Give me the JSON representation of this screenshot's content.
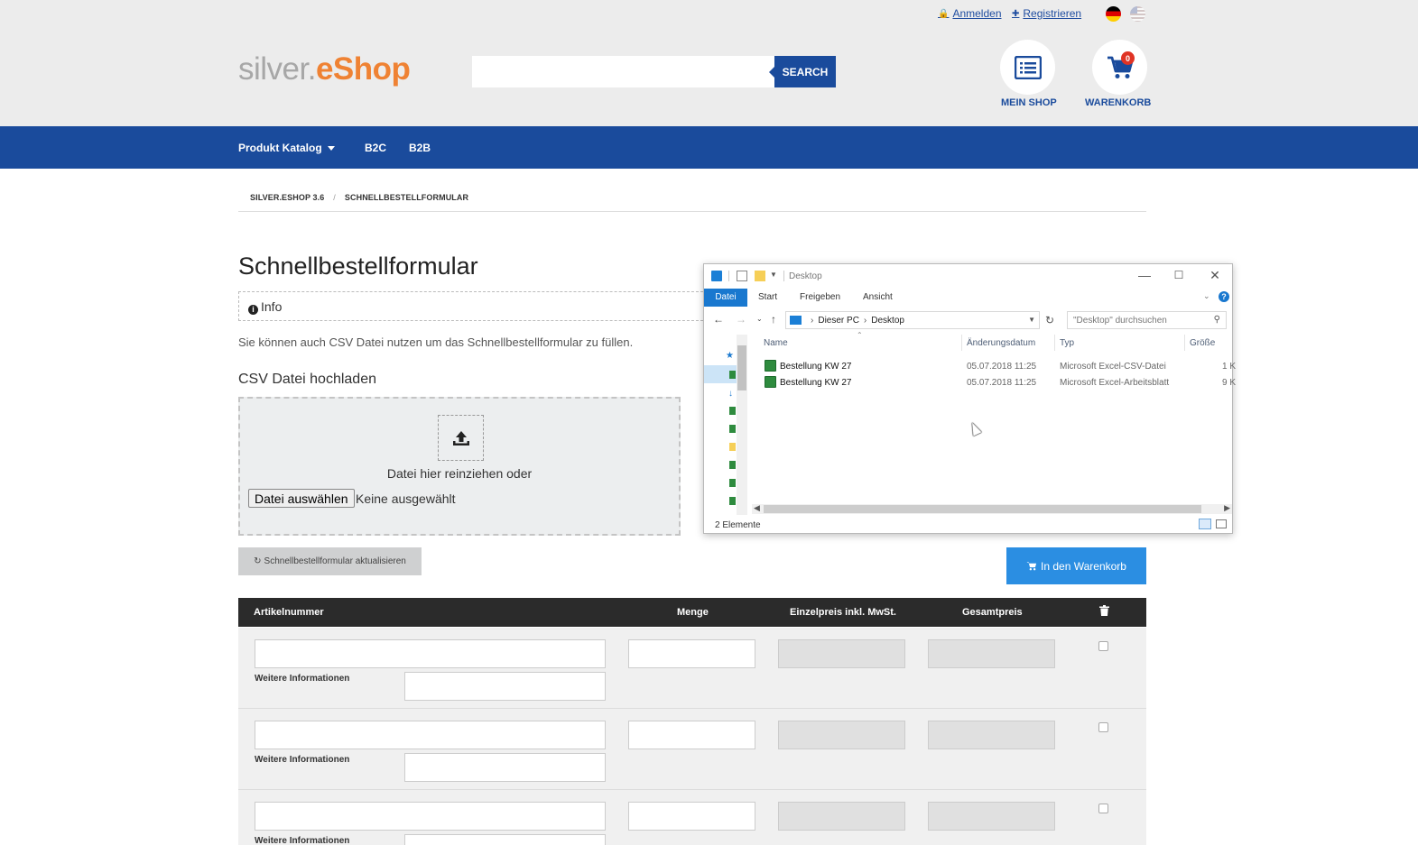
{
  "header": {
    "login_label": "Anmelden",
    "register_label": "Registrieren",
    "logo_part1": "silver.",
    "logo_part2": "eShop",
    "search_button_label": "SEARCH",
    "my_shop_label": "MEIN SHOP",
    "cart_label": "WARENKORB",
    "cart_count": "0"
  },
  "nav": {
    "items": [
      {
        "label": "Produkt Katalog"
      },
      {
        "label": "B2C"
      },
      {
        "label": "B2B"
      }
    ]
  },
  "breadcrumb": {
    "items": [
      "SILVER.ESHOP 3.6",
      "SCHNELLBESTELLFORMULAR"
    ],
    "separator": "/"
  },
  "page": {
    "title": "Schnellbestellformular",
    "info_label": "Info",
    "info_text": "Sie können auch CSV Datei nutzen um das Schnellbestellformular zu füllen.",
    "csv_heading": "CSV Datei hochladen",
    "drop_text": "Datei hier reinziehen oder",
    "file_button_label": "Datei auswählen",
    "file_status": "Keine ausgewählt",
    "update_button_label": "Schnellbestellformular aktualisieren",
    "add_to_cart_label": "In den Warenkorb"
  },
  "table": {
    "columns": [
      "Artikelnummer",
      "Menge",
      "Einzelpreis inkl. MwSt.",
      "Gesamtpreis"
    ],
    "row_info_label": "Weitere Informationen",
    "rows": [
      {
        "article": "",
        "info": "",
        "qty": ""
      },
      {
        "article": "",
        "info": "",
        "qty": ""
      },
      {
        "article": "",
        "info": "",
        "qty": ""
      }
    ]
  },
  "explorer": {
    "title": "Desktop",
    "ribbon_tabs": [
      "Datei",
      "Start",
      "Freigeben",
      "Ansicht"
    ],
    "address": [
      "Dieser PC",
      "Desktop"
    ],
    "search_placeholder": "\"Desktop\" durchsuchen",
    "columns": [
      "Name",
      "Änderungsdatum",
      "Typ",
      "Größe"
    ],
    "files": [
      {
        "name": "Bestellung KW 27",
        "date": "05.07.2018 11:25",
        "type": "Microsoft Excel-CSV-Datei",
        "size": "1 K"
      },
      {
        "name": "Bestellung KW 27",
        "date": "05.07.2018 11:25",
        "type": "Microsoft Excel-Arbeitsblatt",
        "size": "9 K"
      }
    ],
    "status": "2 Elemente"
  },
  "colors": {
    "brand_blue": "#1a4b9c",
    "accent_orange": "#ef8233",
    "cart_button_blue": "#2b8ee2",
    "table_header": "#2b2b2b"
  },
  "icons": {
    "lock": "lock-icon",
    "user_plus": "user-plus-icon",
    "list": "list-icon",
    "cart": "shopping-cart-icon",
    "upload": "upload-icon",
    "refresh": "refresh-icon",
    "trash": "trash-icon",
    "info": "info-icon"
  }
}
